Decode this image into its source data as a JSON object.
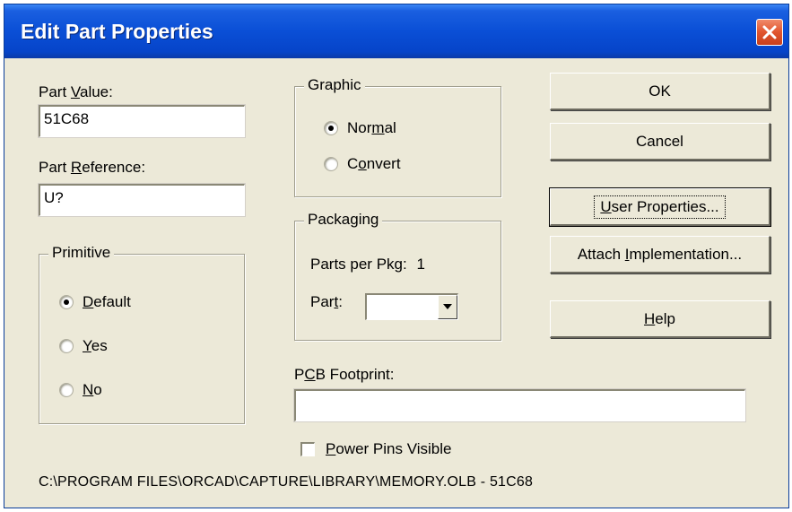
{
  "dialog": {
    "title": "Edit Part Properties"
  },
  "part_value": {
    "label_prefix": "Part ",
    "label_underlined": "V",
    "label_suffix": "alue:",
    "value": "51C68"
  },
  "part_reference": {
    "label_prefix": "Part ",
    "label_underlined": "R",
    "label_suffix": "eference:",
    "value": "U?"
  },
  "primitive": {
    "title": "Primitive",
    "options": [
      {
        "underlined": "D",
        "rest": "efault",
        "selected": true
      },
      {
        "underlined": "Y",
        "rest": "es",
        "selected": false
      },
      {
        "underlined": "N",
        "rest": "o",
        "selected": false
      }
    ]
  },
  "graphic": {
    "title": "Graphic",
    "options": [
      {
        "prefix": "Nor",
        "underlined": "m",
        "rest": "al",
        "selected": true
      },
      {
        "prefix": "C",
        "underlined": "o",
        "rest": "nvert",
        "selected": false
      }
    ]
  },
  "packaging": {
    "title": "Packaging",
    "parts_per_pkg_label": "Parts per Pkg:",
    "parts_per_pkg_value": "1",
    "part_label_prefix": "Par",
    "part_label_underlined": "t",
    "part_label_suffix": ":",
    "part_value": ""
  },
  "pcb_footprint": {
    "label_prefix": "P",
    "label_underlined": "C",
    "label_suffix": "B Footprint:",
    "value": ""
  },
  "power_pins": {
    "label_underlined": "P",
    "label_rest": "ower Pins Visible",
    "checked": false
  },
  "buttons": {
    "ok": "OK",
    "cancel": "Cancel",
    "user_properties_underlined": "U",
    "user_properties_rest": "ser Properties...",
    "attach_prefix": "Attach ",
    "attach_underlined": "I",
    "attach_rest": "mplementation...",
    "help_underlined": "H",
    "help_rest": "elp"
  },
  "status_path": "C:\\PROGRAM FILES\\ORCAD\\CAPTURE\\LIBRARY\\MEMORY.OLB - 51C68",
  "icons": {
    "close": "close-icon",
    "dropdown": "chevron-down-icon"
  },
  "colors": {
    "titlebar": "#0a4fd6",
    "dialog_bg": "#ece9d8",
    "close_button": "#e1552e"
  }
}
